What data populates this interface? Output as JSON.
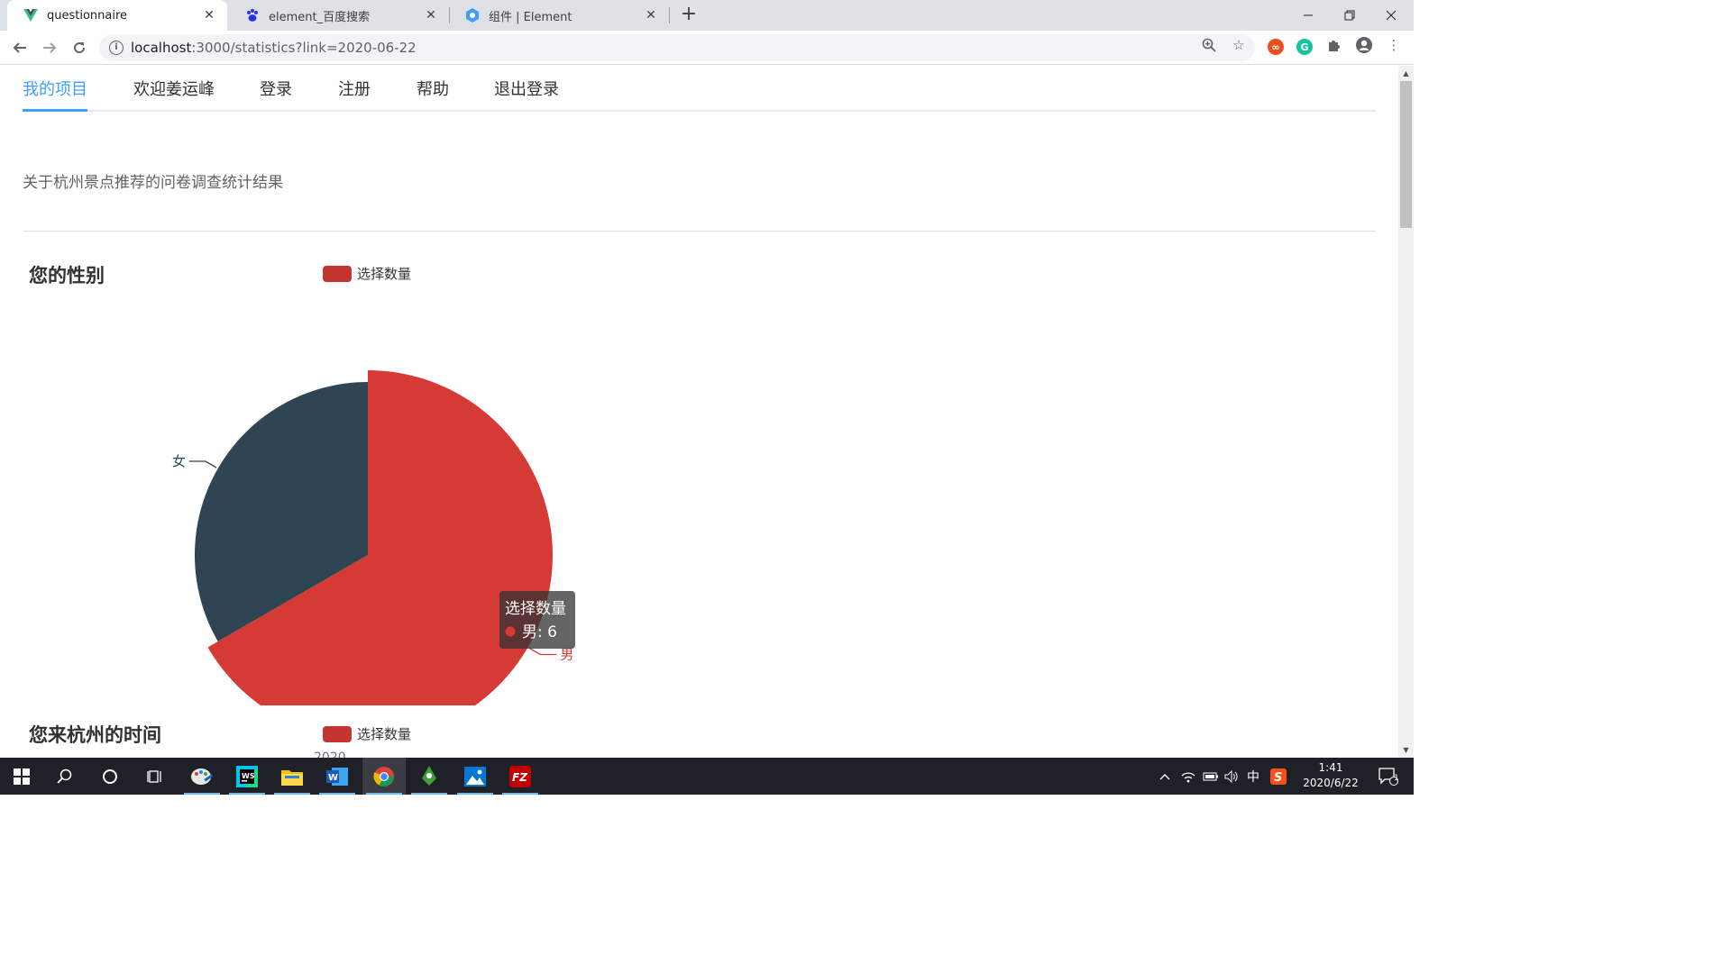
{
  "browser": {
    "tabs": [
      {
        "title": "questionnaire",
        "icon": "vue-triangle-icon",
        "active": true
      },
      {
        "title": "element_百度搜索",
        "icon": "baidu-paw-icon",
        "active": false
      },
      {
        "title": "组件 | Element",
        "icon": "element-logo-icon",
        "active": false
      }
    ],
    "new_tab_symbol": "+",
    "url_host": "localhost",
    "url_path": ":3000/statistics?link=2020-06-22"
  },
  "nav": {
    "items": [
      "我的项目",
      "欢迎姜运峰",
      "登录",
      "注册",
      "帮助",
      "退出登录"
    ],
    "active_index": 0,
    "active_color": "#409eff"
  },
  "survey": {
    "title": "关于杭州景点推荐的问卷调查统计结果"
  },
  "questions": [
    {
      "title": "您的性别",
      "legend": "选择数量"
    },
    {
      "title": "您来杭州的时间",
      "legend": "选择数量",
      "partial_axis_label": "2020"
    }
  ],
  "chart_data": {
    "type": "pie",
    "title": "您的性别",
    "legend": [
      "选择数量"
    ],
    "series": [
      {
        "name": "选择数量",
        "labels": [
          "男",
          "女"
        ],
        "values": [
          6,
          3
        ],
        "colors": [
          "#c23531",
          "#2f4554"
        ]
      }
    ],
    "tooltip": {
      "series_name": "选择数量",
      "label": "男",
      "value": 6,
      "text": "男: 6"
    }
  },
  "taskbar": {
    "apps": [
      "paint-app-icon",
      "webstorm-icon",
      "file-explorer-icon",
      "word-icon",
      "chrome-icon",
      "robo3t-icon",
      "photos-icon",
      "filezilla-icon"
    ],
    "active_app_index": 4,
    "ime": "中",
    "time": "1:41",
    "date": "2020/6/22",
    "notification_count": "1"
  }
}
